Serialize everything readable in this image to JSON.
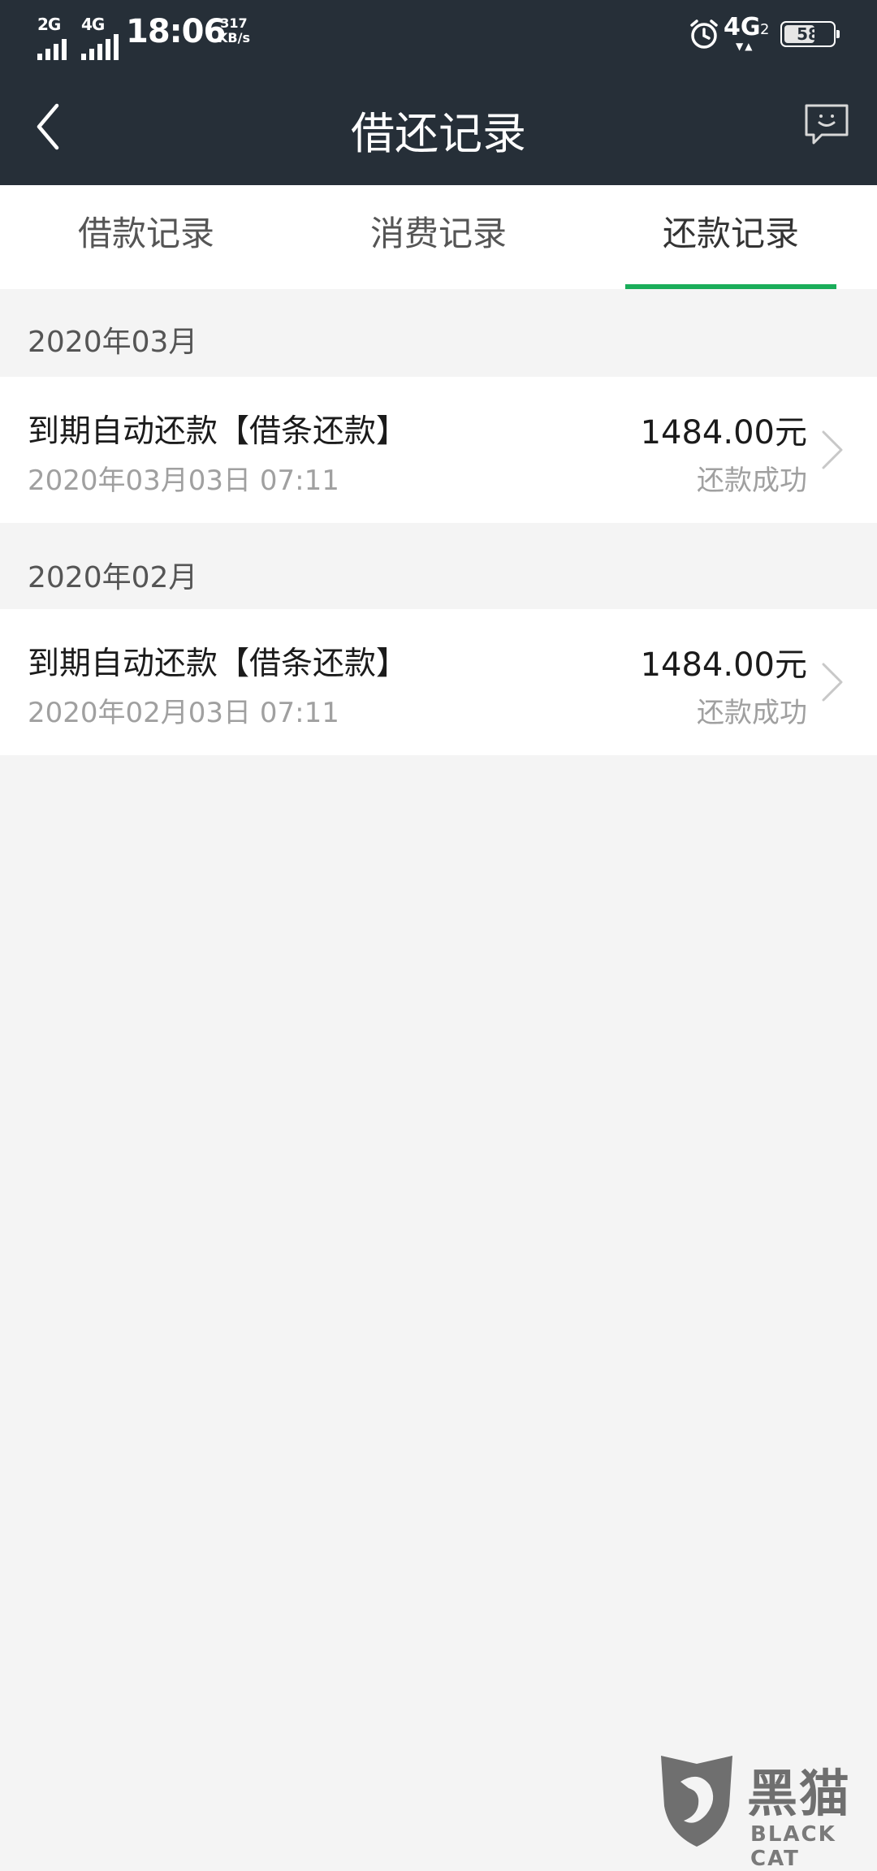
{
  "status_bar": {
    "sim1_network": "2G",
    "sim2_network": "4G",
    "time": "18:06",
    "speed_value": "317",
    "speed_unit": "KB/s",
    "right_network": "4G",
    "right_network_sim": "2",
    "battery_percent": "58",
    "battery_level": 0.58
  },
  "title_bar": {
    "title": "借还记录",
    "back_icon": "chevron-left-icon",
    "feedback_icon": "chat-bubble-smile-icon"
  },
  "tabs": [
    {
      "label": "借款记录",
      "active": false
    },
    {
      "label": "消费记录",
      "active": false
    },
    {
      "label": "还款记录",
      "active": true
    }
  ],
  "accent_color": "#1aad5a",
  "header_color": "#262f38",
  "sections": [
    {
      "month": "2020年03月",
      "records": [
        {
          "title": "到期自动还款【借条还款】",
          "date": "2020年03月03日 07:11",
          "amount": "1484.00元",
          "status": "还款成功"
        }
      ]
    },
    {
      "month": "2020年02月",
      "records": [
        {
          "title": "到期自动还款【借条还款】",
          "date": "2020年02月03日 07:11",
          "amount": "1484.00元",
          "status": "还款成功"
        }
      ]
    }
  ],
  "watermark": {
    "text": "黑猫",
    "sub": "BLACK CAT"
  }
}
